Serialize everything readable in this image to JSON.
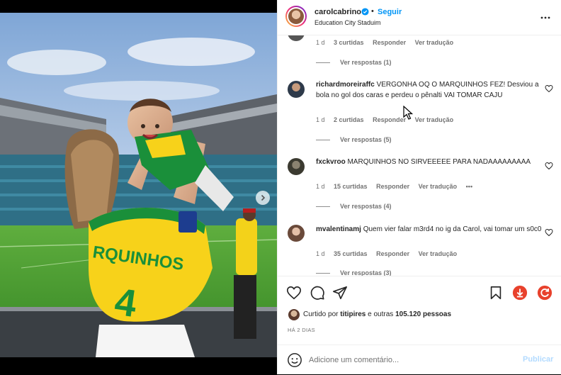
{
  "post": {
    "username": "carolcabrino",
    "follow_label": "Seguir",
    "separator": "•",
    "location": "Education City Staduim"
  },
  "photo": {
    "jersey_text": "RQUINHOS"
  },
  "comments": {
    "top_partial": {
      "time": "1 d",
      "likes": "3 curtidas",
      "reply": "Responder",
      "translate": "Ver tradução",
      "view_replies": "Ver respostas (1)"
    },
    "items": [
      {
        "username": "richardmoreiraffc",
        "text": "VERGONHA OQ O MARQUINHOS FEZ! Desviou a bola no gol dos caras e perdeu o pênalti VAI TOMAR CAJU",
        "time": "1 d",
        "likes": "2 curtidas",
        "reply": "Responder",
        "translate": "Ver tradução",
        "view_replies": "Ver respostas (5)"
      },
      {
        "username": "fxckvroo",
        "text": "MARQUINHOS NO SIRVEEEEE PARA NADAAAAAAAAA",
        "time": "1 d",
        "likes": "15 curtidas",
        "reply": "Responder",
        "translate": "Ver tradução",
        "more": "•••",
        "view_replies": "Ver respostas (4)"
      },
      {
        "username": "mvalentinamj",
        "text": "Quem vier falar m3rd4 no ig da Carol, vai tomar um s0c0",
        "time": "1 d",
        "likes": "35 curtidas",
        "reply": "Responder",
        "translate": "Ver tradução",
        "view_replies": "Ver respostas (3)"
      }
    ]
  },
  "actions": {
    "liked_by": "Curtido por titipires e outras 105.120 pessoas",
    "liked_prefix": "Curtido por",
    "liked_user": "titipires",
    "liked_mid": "e outras",
    "liked_count": "105.120 pessoas",
    "time_ago": "HÁ 2 DIAS",
    "comment_placeholder": "Adicione um comentário...",
    "publish_label": "Publicar"
  },
  "colors": {
    "accent": "#0095f6",
    "publish_disabled": "#b3dbff",
    "jersey_yellow": "#f7d21a",
    "jersey_green": "#1a8f3a"
  },
  "icons": [
    "verified-icon",
    "more-options-icon",
    "heart-icon",
    "comment-icon",
    "share-icon",
    "bookmark-icon",
    "download-icon",
    "refresh-icon",
    "emoji-icon",
    "chevron-right-icon",
    "cursor-icon"
  ]
}
